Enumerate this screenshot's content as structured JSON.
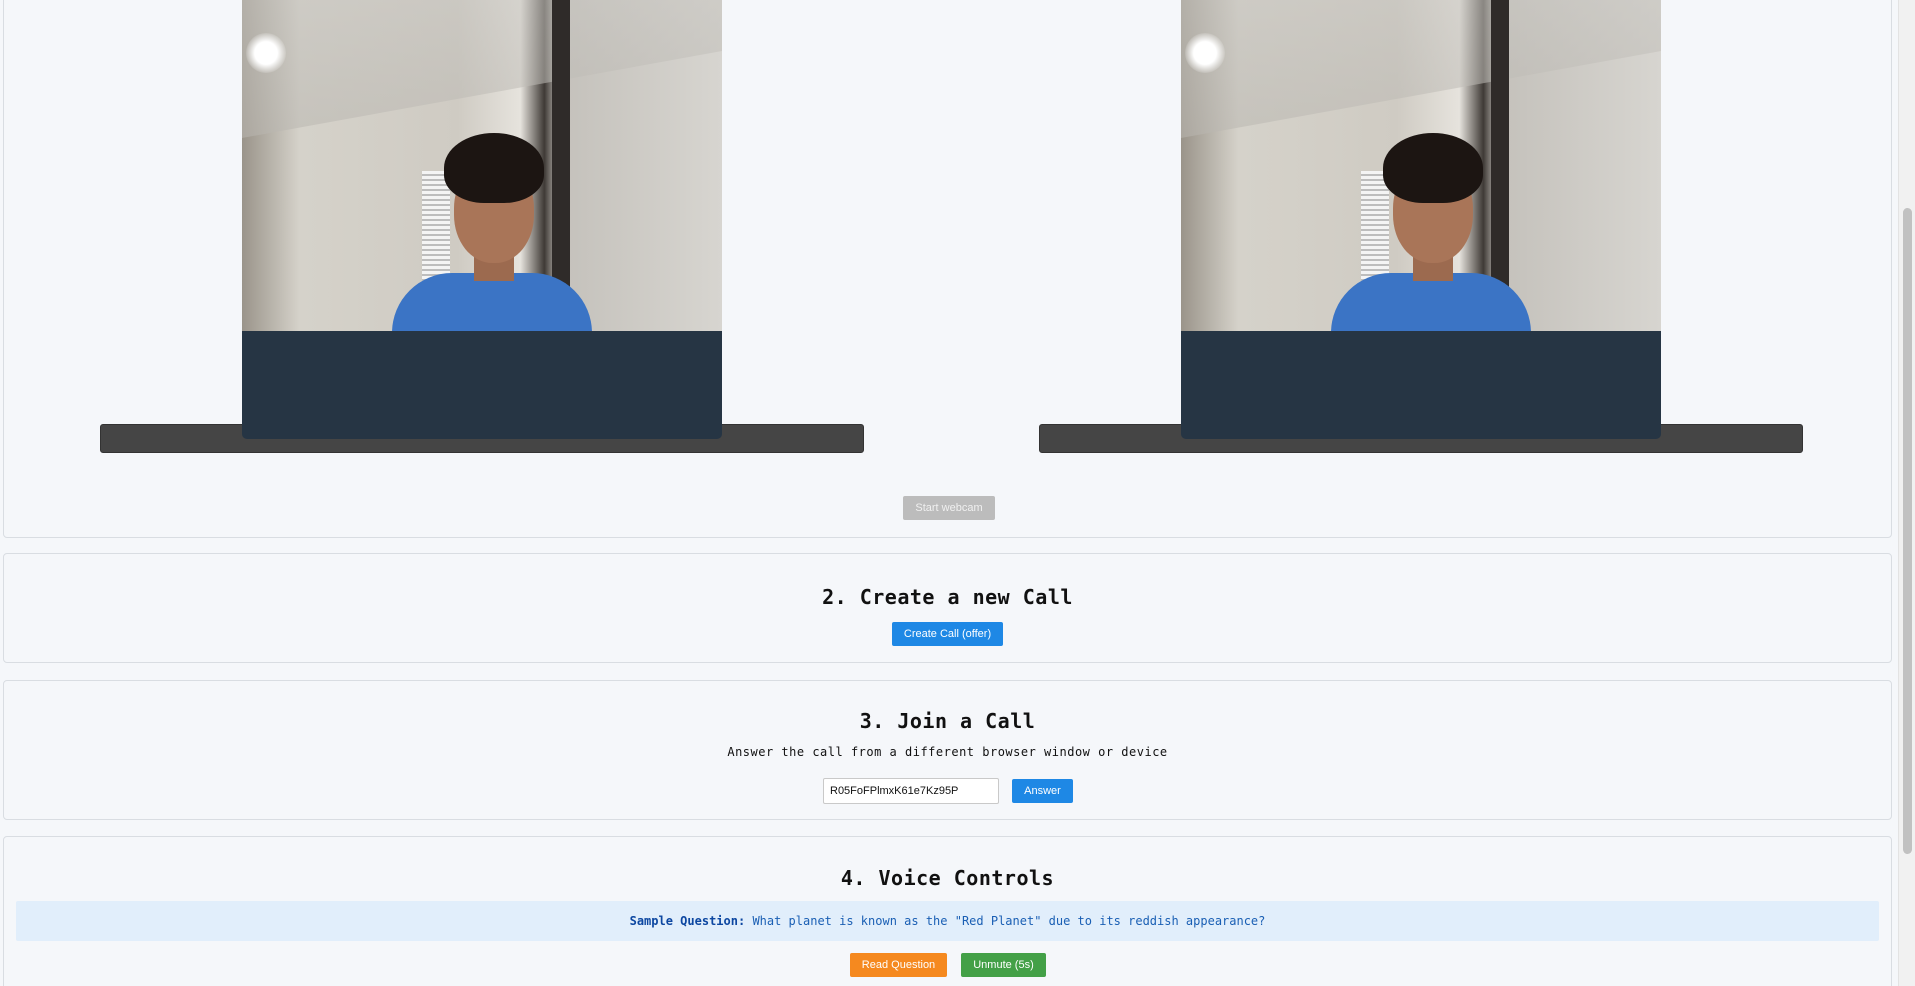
{
  "webcam": {
    "start_label": "Start webcam"
  },
  "create_call": {
    "heading": "2. Create a new Call",
    "button_label": "Create Call (offer)"
  },
  "join_call": {
    "heading": "3. Join a Call",
    "subtitle": "Answer the call from a different browser window or device",
    "call_id_value": "R05FoFPlmxK61e7Kz95P",
    "answer_label": "Answer"
  },
  "voice_controls": {
    "heading": "4. Voice Controls",
    "question_label": "Sample Question:",
    "question_text": "What planet is known as the \"Red Planet\" due to its reddish appearance?",
    "read_label": "Read Question",
    "unmute_label": "Unmute (5s)"
  },
  "colors": {
    "primary_button": "#1e88e5",
    "read_button": "#f5891f",
    "unmute_button": "#43a047",
    "video_background": "#263544",
    "question_background": "#e1eefb"
  },
  "icons": {}
}
